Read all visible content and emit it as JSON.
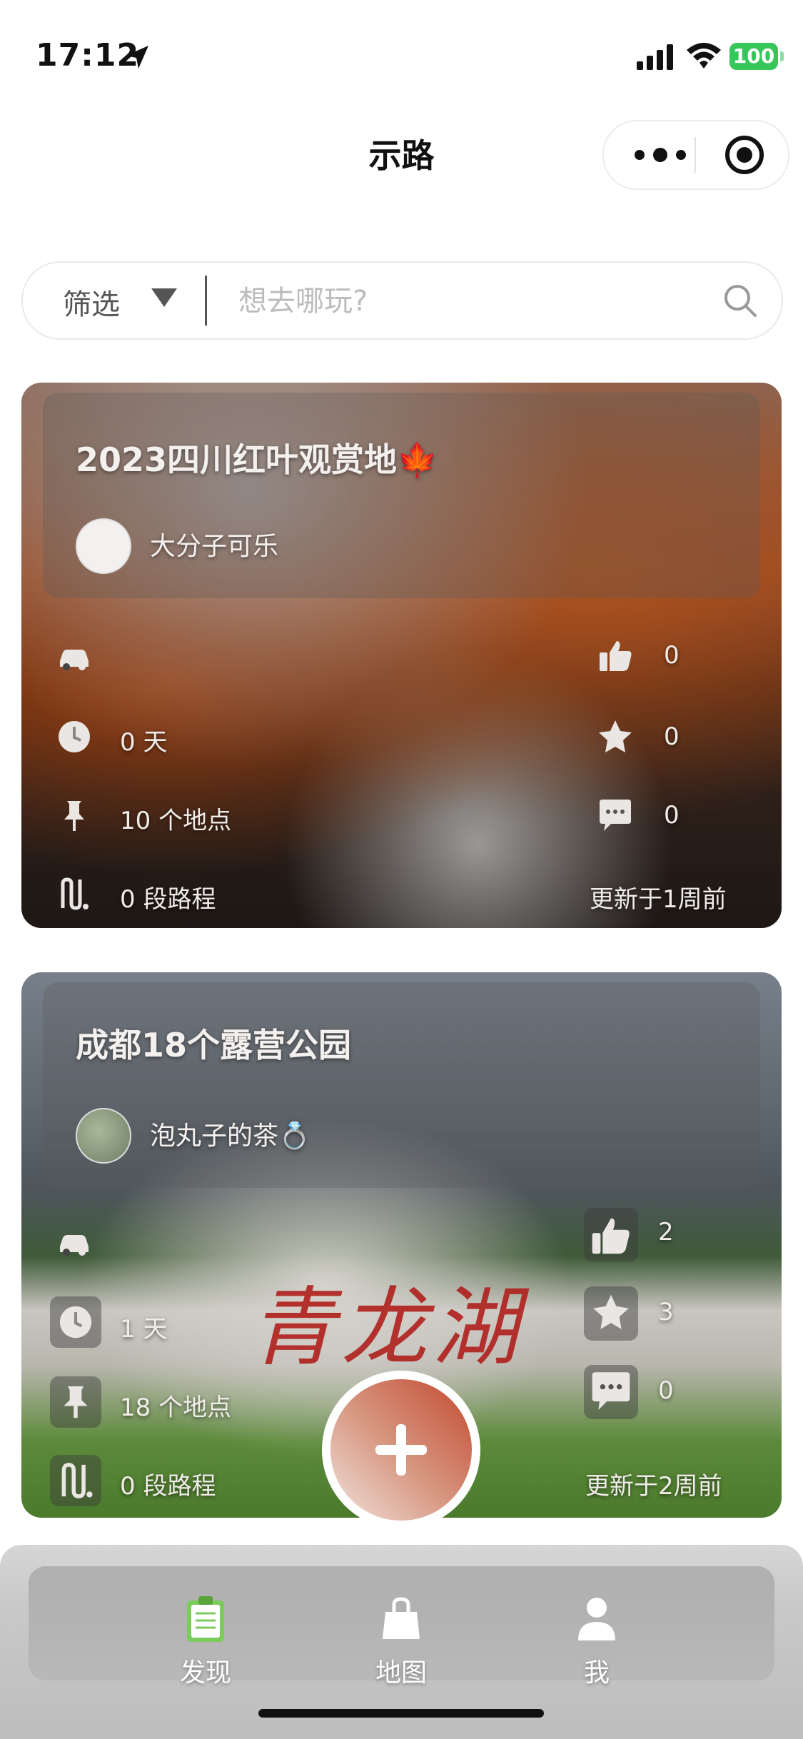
{
  "status_bar": {
    "time": "17:12",
    "battery": "100"
  },
  "header": {
    "title": "示路"
  },
  "search": {
    "filter_label": "筛选",
    "placeholder": "想去哪玩?"
  },
  "routes": [
    {
      "title": "2023四川红叶观赏地🍁",
      "author": "大分子可乐",
      "likes": "0",
      "days": "0 天",
      "stars": "0",
      "places": "10 个地点",
      "comments": "0",
      "segments": "0 段路程",
      "updated": "更新于1周前"
    },
    {
      "title": "成都18个露营公园",
      "author": "泡丸子的茶💍",
      "likes": "2",
      "days": "1 天",
      "stars": "3",
      "places": "18 个地点",
      "comments": "0",
      "segments": "0 段路程",
      "updated": "更新于2周前",
      "sign_text": "青龙湖"
    }
  ],
  "tab_bar": {
    "items": [
      {
        "label": "发现"
      },
      {
        "label": "地图"
      },
      {
        "label": "我"
      }
    ]
  },
  "icons": {
    "car": "car-icon",
    "clock": "clock-icon",
    "pin": "pin-icon",
    "route": "route-icon",
    "like": "thumbs-up-icon",
    "star": "star-icon",
    "comment": "comment-icon",
    "add": "plus-icon"
  },
  "colors": {
    "battery": "#35c759",
    "fab_gradient_end": "#c2482f",
    "placeholder": "#bbbbbb"
  }
}
